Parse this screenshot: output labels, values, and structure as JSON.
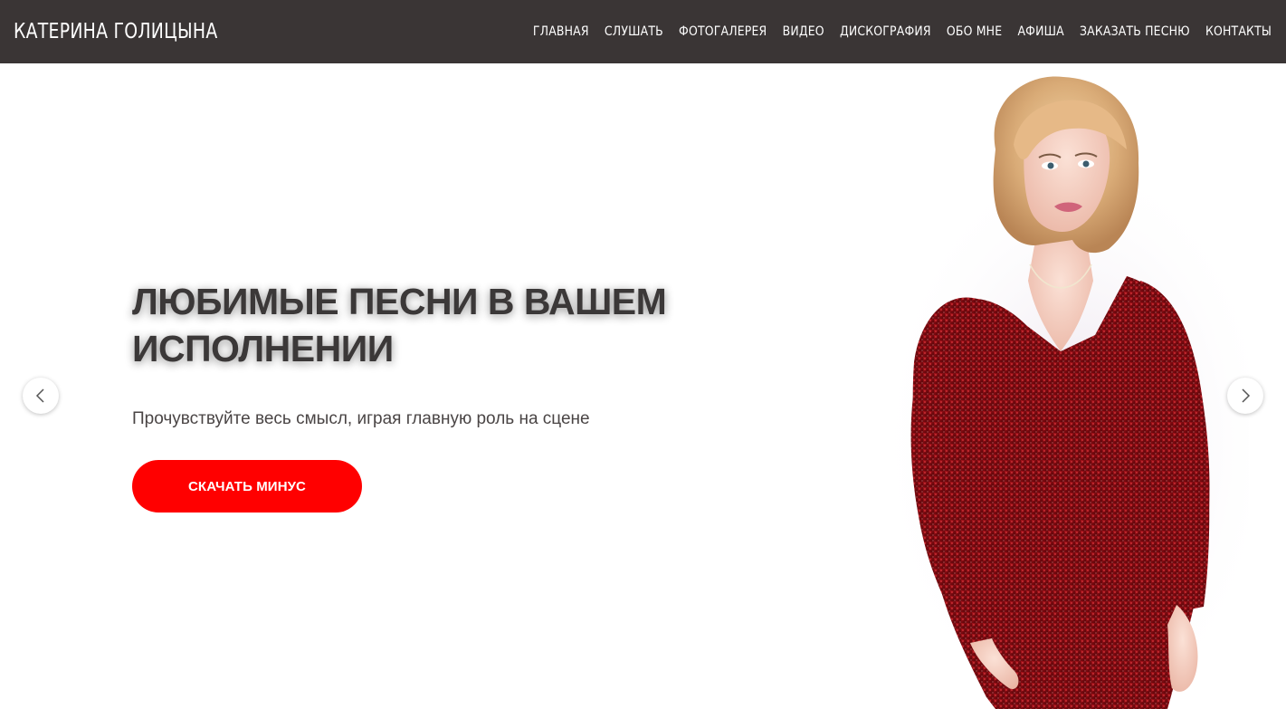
{
  "header": {
    "brand": "КАТЕРИНА ГОЛИЦЫНА",
    "nav": [
      {
        "label": "ГЛАВНАЯ"
      },
      {
        "label": "СЛУШАТЬ"
      },
      {
        "label": "ФОТОГАЛЕРЕЯ"
      },
      {
        "label": "ВИДЕО"
      },
      {
        "label": "ДИСКОГРАФИЯ"
      },
      {
        "label": "ОБО МНЕ"
      },
      {
        "label": "АФИША"
      },
      {
        "label": "ЗАКАЗАТЬ ПЕСНЮ"
      },
      {
        "label": "КОНТАКТЫ"
      }
    ]
  },
  "hero": {
    "headline": "ЛЮБИМЫЕ ПЕСНИ В ВАШЕМ ИСПОЛНЕНИИ",
    "subtitle": "Прочувствуйте весь смысл, играя главную роль на сцене",
    "cta_label": "СКАЧАТЬ МИНУС",
    "prev_icon": "chevron-left-icon",
    "next_icon": "chevron-right-icon"
  },
  "colors": {
    "header_bg": "#3a3535",
    "accent": "#ff0000",
    "headline": "#3b3838",
    "dress": "#8b0f14"
  }
}
